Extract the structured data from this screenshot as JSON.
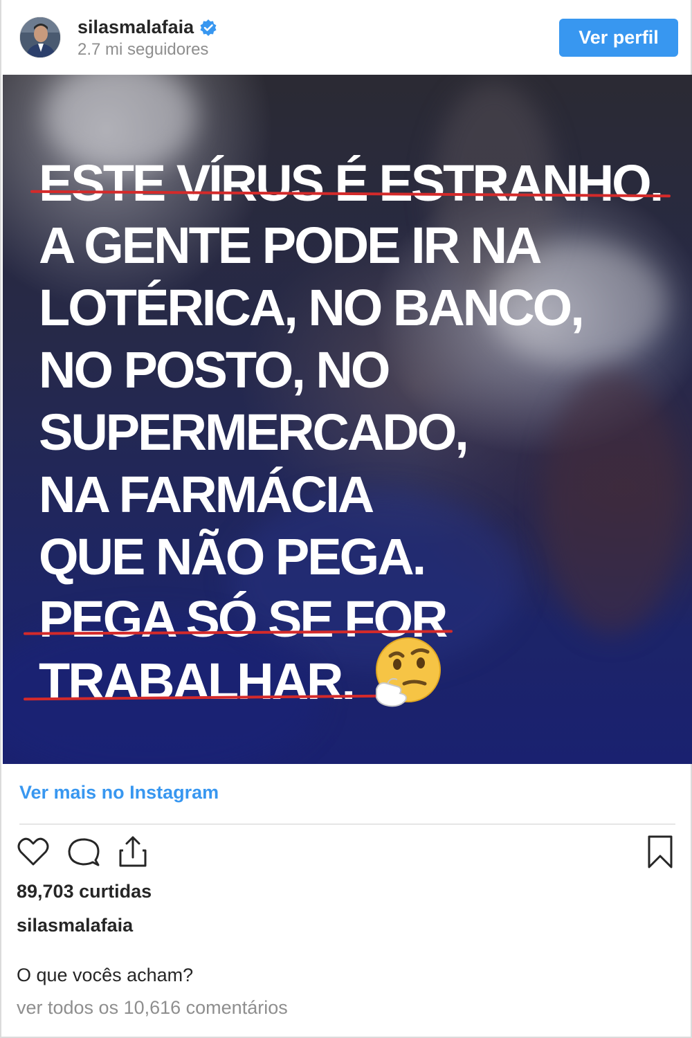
{
  "header": {
    "username": "silasmalafaia",
    "followers": "2.7 mi seguidores",
    "view_profile_label": "Ver perfil"
  },
  "post": {
    "image_text_lines": [
      "ESTE VÍRUS É ESTRANHO.",
      "A GENTE PODE IR NA",
      "LOTÉRICA, NO BANCO,",
      "NO POSTO, NO",
      "SUPERMERCADO,",
      "NA FARMÁCIA",
      "QUE NÃO PEGA.",
      "PEGA SÓ SE FOR",
      "TRABALHAR."
    ],
    "emoji": "thinking-face-emoji"
  },
  "footer": {
    "more_link": "Ver mais no Instagram",
    "likes": "89,703 curtidas",
    "author": "silasmalafaia",
    "caption": "O que vocês acham?",
    "comments_link": "ver todos os 10,616 comentários"
  },
  "icons": {
    "verified": "verified-badge-icon",
    "like": "heart-icon",
    "comment": "comment-bubble-icon",
    "share": "share-icon",
    "save": "bookmark-icon"
  },
  "colors": {
    "accent": "#3897f0",
    "underline": "#d42a2a",
    "text": "#262626",
    "muted": "#8e8e8e"
  }
}
